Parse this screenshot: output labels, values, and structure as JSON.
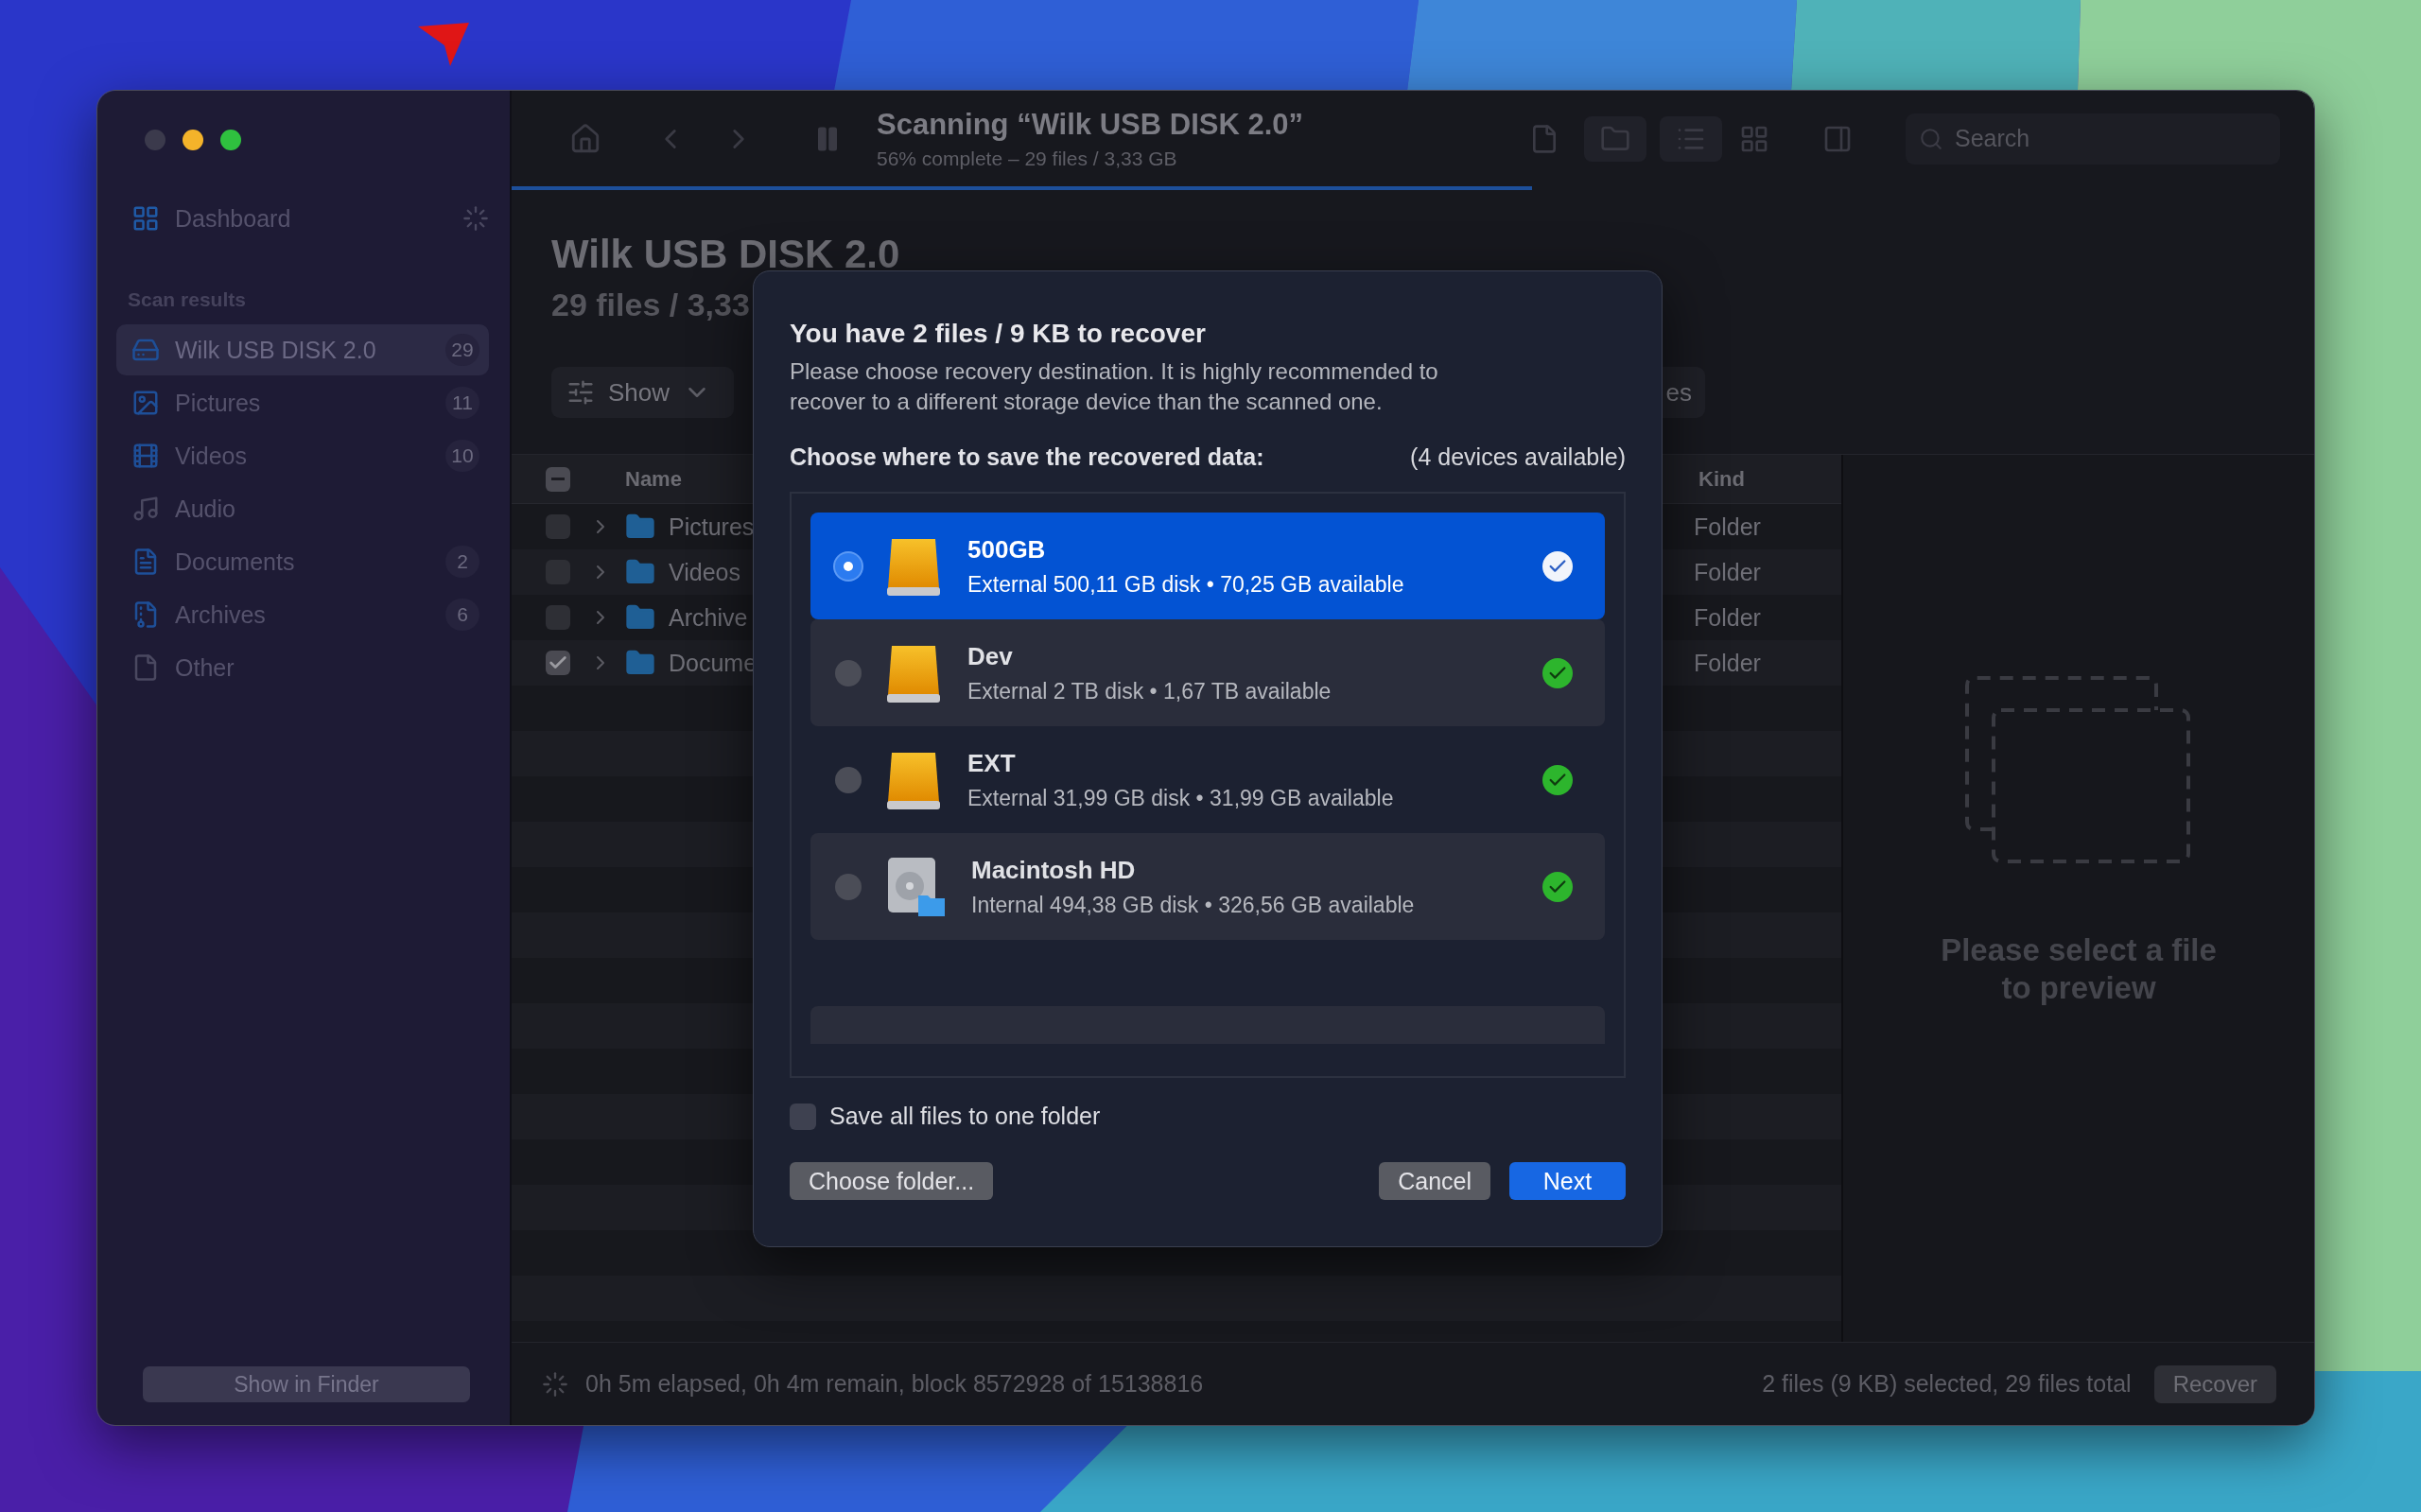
{
  "sidebar": {
    "dashboard": "Dashboard",
    "section": "Scan results",
    "items": [
      {
        "label": "Wilk USB DISK 2.0",
        "count": "29",
        "selected": true
      },
      {
        "label": "Pictures",
        "count": "11",
        "selected": false
      },
      {
        "label": "Videos",
        "count": "10",
        "selected": false
      },
      {
        "label": "Audio",
        "selected": false
      },
      {
        "label": "Documents",
        "count": "2",
        "selected": false
      },
      {
        "label": "Archives",
        "count": "6",
        "selected": false
      },
      {
        "label": "Other",
        "selected": false
      }
    ],
    "finder_button": "Show in Finder"
  },
  "toolbar": {
    "title": "Scanning “Wilk USB DISK 2.0”",
    "subtitle": "56% complete – 29 files / 3,33 GB",
    "search": {
      "placeholder": "Search"
    },
    "progress": {
      "level": 0.566
    }
  },
  "content": {
    "title": "Wilk USB DISK 2.0",
    "subtitle": "29 files / 3,33",
    "show_button": "Show",
    "partial_button": "es"
  },
  "table": {
    "columns": [
      "Name",
      "Kind"
    ],
    "header_checkbox": {
      "mixed": true
    },
    "rows": [
      {
        "name": "Pictures",
        "kind_cell": "Folder",
        "checked": false
      },
      {
        "name": "Videos",
        "kind_cell": "Folder",
        "checked": false
      },
      {
        "name": "Archive",
        "kind_cell": "Folder",
        "checked": false
      },
      {
        "name": "Docume",
        "kind_cell": "Folder",
        "checked": true
      }
    ]
  },
  "preview": {
    "message": "Please select a file to preview"
  },
  "dialog": {
    "title": "You have 2 files / 9 KB to recover",
    "description": "Please choose recovery destination. It is highly recommended to recover to a different storage device than the scanned one.",
    "prompt": "Choose where to save the recovered data:",
    "count": "(4 devices available)",
    "devices": [
      {
        "name": "500GB",
        "detail": "External 500,11 GB disk • 70,25 GB available",
        "selected": true,
        "kind": "external"
      },
      {
        "name": "Dev",
        "detail": "External 2 TB disk • 1,67 TB available",
        "selected": false,
        "kind": "external"
      },
      {
        "name": "EXT",
        "detail": "External 31,99 GB disk • 31,99 GB available",
        "selected": false,
        "kind": "external"
      },
      {
        "name": "Macintosh HD",
        "detail": "Internal 494,38 GB disk • 326,56 GB available",
        "selected": false,
        "kind": "internal"
      }
    ],
    "one_folder": {
      "label": "Save all files to one folder",
      "checked": false
    },
    "choose_button": "Choose folder...",
    "cancel_button": "Cancel",
    "next_button": "Next"
  },
  "status_bar": {
    "progress_text": "0h 5m elapsed, 0h 4m remain, block 8572928 of 15138816",
    "selection_text": "2 files (9 KB) selected, 29 files total",
    "recover_button": "Recover"
  }
}
